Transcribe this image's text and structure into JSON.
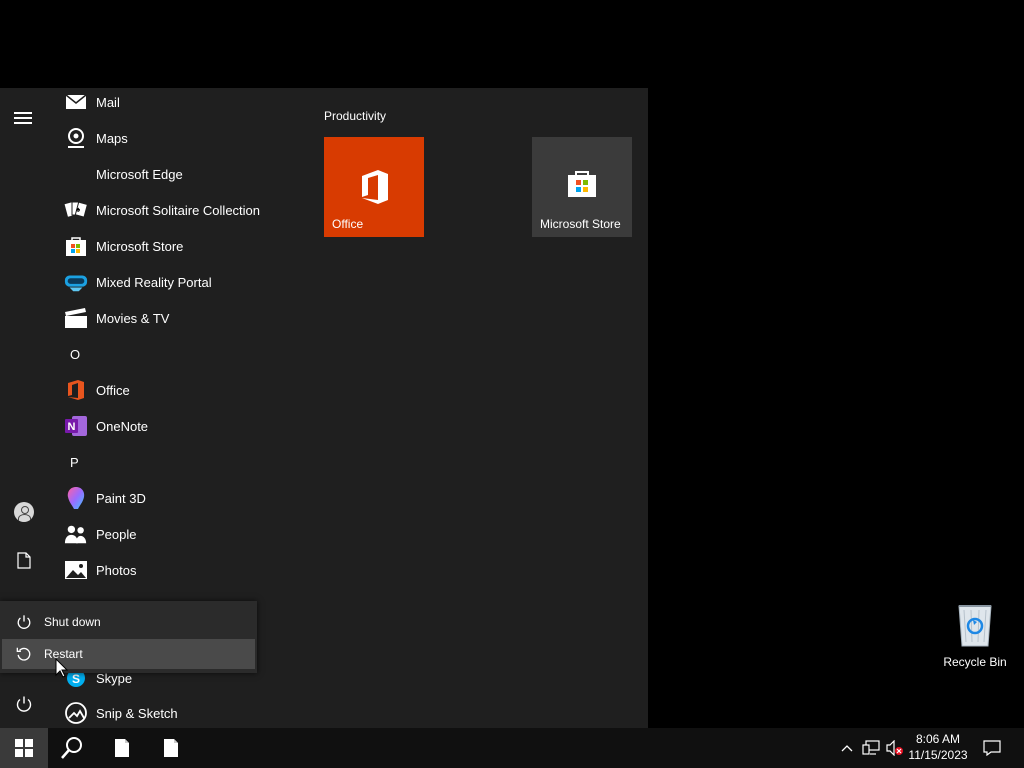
{
  "start_menu": {
    "apps": [
      {
        "label": "Mail",
        "icon": "mail-icon"
      },
      {
        "label": "Maps",
        "icon": "maps-icon"
      },
      {
        "label": "Microsoft Edge",
        "icon": "edge-icon"
      },
      {
        "label": "Microsoft Solitaire Collection",
        "icon": "solitaire-icon"
      },
      {
        "label": "Microsoft Store",
        "icon": "store-icon"
      },
      {
        "label": "Mixed Reality Portal",
        "icon": "mixed-reality-icon"
      },
      {
        "label": "Movies & TV",
        "icon": "movies-icon"
      },
      {
        "label": "Office",
        "icon": "office-icon"
      },
      {
        "label": "OneNote",
        "icon": "onenote-icon"
      },
      {
        "label": "Paint 3D",
        "icon": "paint3d-icon"
      },
      {
        "label": "People",
        "icon": "people-icon"
      },
      {
        "label": "Photos",
        "icon": "photos-icon"
      },
      {
        "label": "Skype",
        "icon": "skype-icon"
      },
      {
        "label": "Snip & Sketch",
        "icon": "snip-icon"
      }
    ],
    "letters": {
      "o": "O",
      "p": "P"
    },
    "group_title": "Productivity",
    "tiles": {
      "office": "Office",
      "store": "Microsoft Store"
    }
  },
  "power_menu": {
    "shutdown": "Shut down",
    "restart": "Restart",
    "selected": "Restart"
  },
  "desktop": {
    "recycle_bin": "Recycle Bin"
  },
  "taskbar": {
    "time": "8:06 AM",
    "date": "11/15/2023"
  },
  "colors": {
    "office_tile": "#d83b01",
    "store_tile": "#3b3b3b",
    "menu_bg": "#1f1f1f",
    "taskbar_bg": "#101010"
  }
}
